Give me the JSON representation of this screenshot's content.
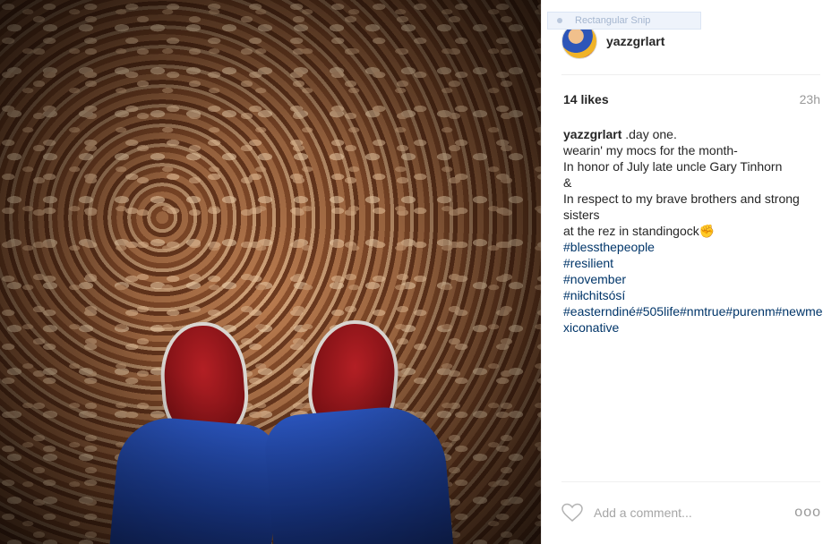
{
  "post": {
    "username": "yazzgrlart",
    "likes": "14 likes",
    "time": "23h",
    "caption": {
      "author": "yazzgrlart",
      "first_line": ".day one.",
      "lines": [
        "wearin' my mocs for the month-",
        "In honor of July late uncle Gary Tinhorn",
        "&",
        "In respect to my brave brothers and strong sisters",
        "at the rez in standingock✊"
      ],
      "hashtags": [
        "#blessthepeople",
        "#resilient",
        "#november",
        "#niłchitsósí"
      ],
      "hashtag_run": "#easterndiné#505life#nmtrue#purenm#newmexiconative"
    },
    "comment_placeholder": "Add a comment...",
    "more_label": "ooo"
  },
  "overlay": {
    "snip_label": "Rectangular Snip"
  },
  "icons": {
    "like": "heart-icon",
    "options": "more-options-icon"
  }
}
